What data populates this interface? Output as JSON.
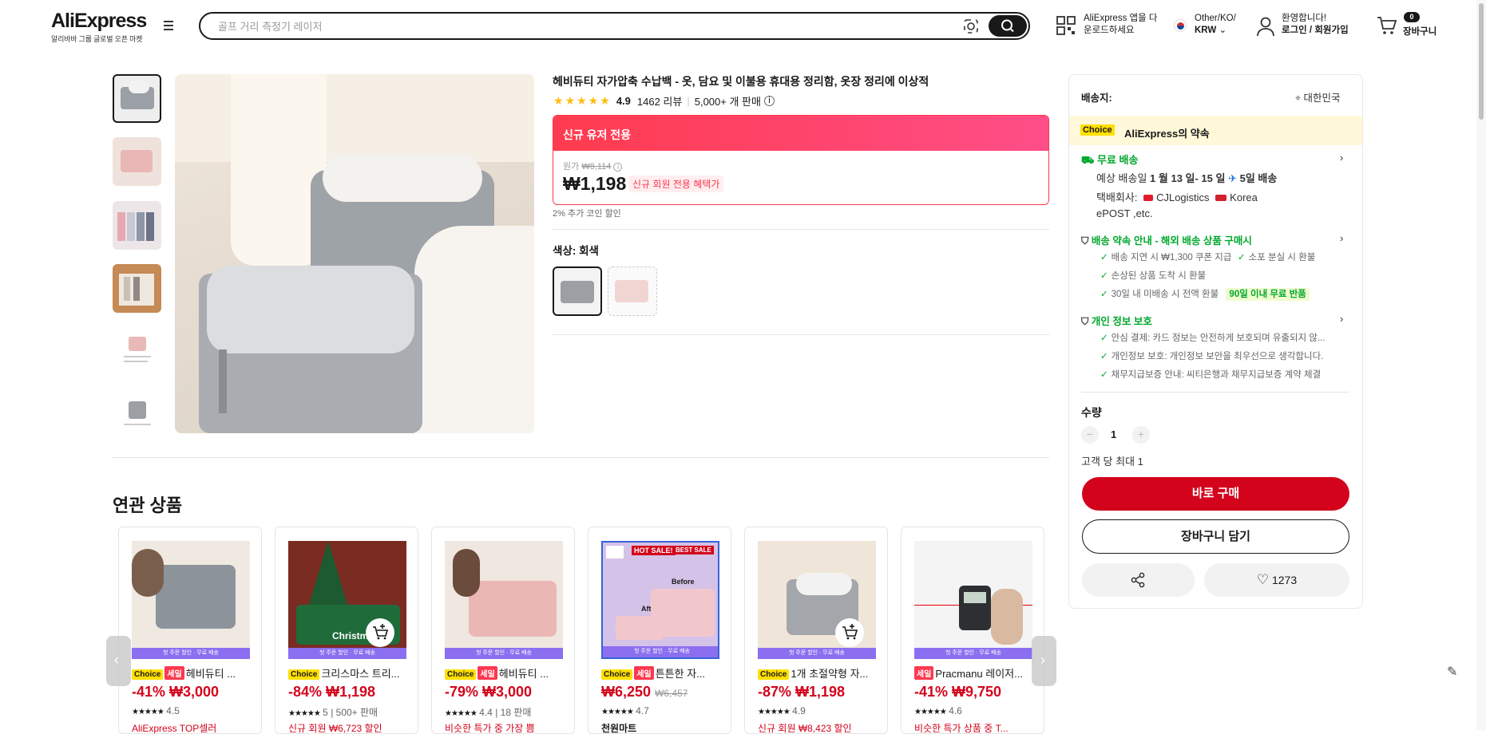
{
  "header": {
    "logo": "AliExpress",
    "logo_sub": "알리바바 그룹 글로벌 오픈 마켓",
    "search_placeholder": "골프 거리 측정기 레이저",
    "app_line1": "AliExpress 앱을 다",
    "app_line2": "운로드하세요",
    "region_line1": "Other/KO/",
    "region_line2": "KRW",
    "account_line1": "환영합니다!",
    "account_line2": "로그인 / 회원가입",
    "cart_count": "0",
    "cart_label": "장바구니"
  },
  "product": {
    "title": "헤비듀티 자가압축 수납백 - 옷, 담요 및 이불용 휴대용 정리함, 옷장 정리에 이상적",
    "rating": "4.9",
    "reviews": "1462 리뷰",
    "sold": "5,000+ 개 판매",
    "promo_header": "신규 유저 전용",
    "orig_label": "원가",
    "orig_price": "₩8,114",
    "price": "₩1,198",
    "price_badge": "신규 회원 전용 혜택가",
    "coin_discount": "2% 추가 코인 할인",
    "color_label": "색상: 회색"
  },
  "shipping_panel": {
    "ship_to_label": "배송지:",
    "ship_to_value": "대한민국",
    "choice_badge": "Choice",
    "choice_promise": "AliExpress의 약속",
    "free_shipping": "무료 배송",
    "delivery_prefix": "예상 배송일",
    "delivery_dates": "1 월 13 일- 15 일",
    "delivery_days": "5일 배송",
    "courier_label": "택배회사:",
    "courier_1": "CJLogistics",
    "courier_2": "Korea",
    "courier_3": "ePOST ,etc.",
    "guarantee_title": "배송 약속 안내 - 해외 배송 상품 구매시",
    "g1": "배송 지연 시 ₩1,300 쿠폰 지급",
    "g2": "소포 분실 시 환불",
    "g3": "손상된 상품 도착 시 환불",
    "g4": "30일 내 미배송 시 전액 환불",
    "g4_badge": "90일 이내 무료 반품",
    "privacy_title": "개인 정보 보호",
    "p1": "안심 결제: 카드 정보는 안전하게 보호되며 유출되지 않...",
    "p2": "개인정보 보호: 개인정보 보안을 최우선으로 생각합니다.",
    "p3": "채무지급보증 안내: 씨티은행과 채무지급보증 계약 체결",
    "qty_label": "수량",
    "qty_value": "1",
    "qty_limit": "고객 당 최대 1",
    "buy_now": "바로 구매",
    "add_cart": "장바구니 담기",
    "wish_count": "1273"
  },
  "related": {
    "title": "연관 상품",
    "band": "첫 주문 할인 · 무료 배송",
    "items": [
      {
        "choice": "Choice",
        "sale": "세일",
        "name": "헤비듀티 ...",
        "price": "-41% ₩3,000",
        "orig": "",
        "stars": "★★★★★",
        "rating": "4.5",
        "extra": "",
        "tag": "AliExpress TOP셀러"
      },
      {
        "choice": "Choice",
        "sale": "",
        "name": "크리스마스 트리...",
        "price": "-84% ₩1,198",
        "orig": "",
        "stars": "★★★★★",
        "rating": "5",
        "extra": "500+ 판매",
        "tag": "신규 회원 ₩6,723 할인"
      },
      {
        "choice": "Choice",
        "sale": "세일",
        "name": "헤비듀티 ...",
        "price": "-79% ₩3,000",
        "orig": "",
        "stars": "★★★★★",
        "rating": "4.4",
        "extra": "18 판매",
        "tag": "비슷한 특가 중 가장 쁨"
      },
      {
        "choice": "Choice",
        "sale": "세일",
        "name": "튼튼한 자...",
        "price": "₩6,250",
        "orig": "₩6,457",
        "stars": "★★★★★",
        "rating": "4.7",
        "extra": "",
        "tag": "천원마트"
      },
      {
        "choice": "Choice",
        "sale": "",
        "name": "1개 초절약형 자...",
        "price": "-87% ₩1,198",
        "orig": "",
        "stars": "★★★★★",
        "rating": "4.9",
        "extra": "",
        "tag": "신규 회원 ₩8,423 할인"
      },
      {
        "choice": "",
        "sale": "세일",
        "name": "Pracmanu 레이저...",
        "price": "-41% ₩9,750",
        "orig": "",
        "stars": "★★★★★",
        "rating": "4.6",
        "extra": "",
        "tag": "비슷한 특가 상품 중 T..."
      }
    ],
    "img4_hot": "HOT SALE!",
    "img4_best": "BEST SALE",
    "img4_before": "Before",
    "img4_after": "After",
    "img2_text": "Christmas"
  },
  "icons": {
    "search": "search-icon",
    "camera": "camera-icon",
    "qr": "qr-icon",
    "user": "user-icon",
    "cart": "cart-icon"
  },
  "colors": {
    "accent_red": "#d3031c",
    "promo_pink": "#fd384f",
    "choice_yellow": "#ffe000",
    "green": "#00a82d"
  }
}
